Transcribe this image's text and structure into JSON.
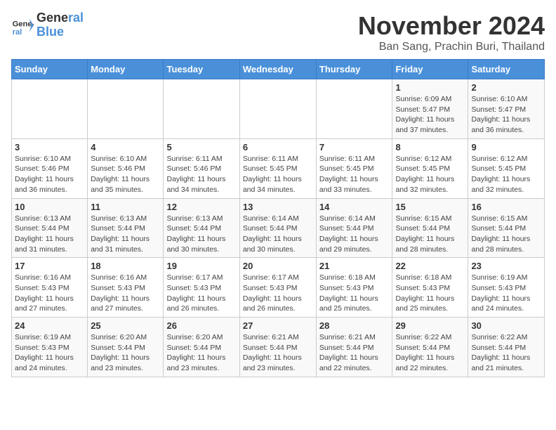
{
  "logo": {
    "line1": "General",
    "line2": "Blue"
  },
  "title": "November 2024",
  "location": "Ban Sang, Prachin Buri, Thailand",
  "weekdays": [
    "Sunday",
    "Monday",
    "Tuesday",
    "Wednesday",
    "Thursday",
    "Friday",
    "Saturday"
  ],
  "weeks": [
    [
      {
        "day": "",
        "info": ""
      },
      {
        "day": "",
        "info": ""
      },
      {
        "day": "",
        "info": ""
      },
      {
        "day": "",
        "info": ""
      },
      {
        "day": "",
        "info": ""
      },
      {
        "day": "1",
        "info": "Sunrise: 6:09 AM\nSunset: 5:47 PM\nDaylight: 11 hours and 37 minutes."
      },
      {
        "day": "2",
        "info": "Sunrise: 6:10 AM\nSunset: 5:47 PM\nDaylight: 11 hours and 36 minutes."
      }
    ],
    [
      {
        "day": "3",
        "info": "Sunrise: 6:10 AM\nSunset: 5:46 PM\nDaylight: 11 hours and 36 minutes."
      },
      {
        "day": "4",
        "info": "Sunrise: 6:10 AM\nSunset: 5:46 PM\nDaylight: 11 hours and 35 minutes."
      },
      {
        "day": "5",
        "info": "Sunrise: 6:11 AM\nSunset: 5:46 PM\nDaylight: 11 hours and 34 minutes."
      },
      {
        "day": "6",
        "info": "Sunrise: 6:11 AM\nSunset: 5:45 PM\nDaylight: 11 hours and 34 minutes."
      },
      {
        "day": "7",
        "info": "Sunrise: 6:11 AM\nSunset: 5:45 PM\nDaylight: 11 hours and 33 minutes."
      },
      {
        "day": "8",
        "info": "Sunrise: 6:12 AM\nSunset: 5:45 PM\nDaylight: 11 hours and 32 minutes."
      },
      {
        "day": "9",
        "info": "Sunrise: 6:12 AM\nSunset: 5:45 PM\nDaylight: 11 hours and 32 minutes."
      }
    ],
    [
      {
        "day": "10",
        "info": "Sunrise: 6:13 AM\nSunset: 5:44 PM\nDaylight: 11 hours and 31 minutes."
      },
      {
        "day": "11",
        "info": "Sunrise: 6:13 AM\nSunset: 5:44 PM\nDaylight: 11 hours and 31 minutes."
      },
      {
        "day": "12",
        "info": "Sunrise: 6:13 AM\nSunset: 5:44 PM\nDaylight: 11 hours and 30 minutes."
      },
      {
        "day": "13",
        "info": "Sunrise: 6:14 AM\nSunset: 5:44 PM\nDaylight: 11 hours and 30 minutes."
      },
      {
        "day": "14",
        "info": "Sunrise: 6:14 AM\nSunset: 5:44 PM\nDaylight: 11 hours and 29 minutes."
      },
      {
        "day": "15",
        "info": "Sunrise: 6:15 AM\nSunset: 5:44 PM\nDaylight: 11 hours and 28 minutes."
      },
      {
        "day": "16",
        "info": "Sunrise: 6:15 AM\nSunset: 5:44 PM\nDaylight: 11 hours and 28 minutes."
      }
    ],
    [
      {
        "day": "17",
        "info": "Sunrise: 6:16 AM\nSunset: 5:43 PM\nDaylight: 11 hours and 27 minutes."
      },
      {
        "day": "18",
        "info": "Sunrise: 6:16 AM\nSunset: 5:43 PM\nDaylight: 11 hours and 27 minutes."
      },
      {
        "day": "19",
        "info": "Sunrise: 6:17 AM\nSunset: 5:43 PM\nDaylight: 11 hours and 26 minutes."
      },
      {
        "day": "20",
        "info": "Sunrise: 6:17 AM\nSunset: 5:43 PM\nDaylight: 11 hours and 26 minutes."
      },
      {
        "day": "21",
        "info": "Sunrise: 6:18 AM\nSunset: 5:43 PM\nDaylight: 11 hours and 25 minutes."
      },
      {
        "day": "22",
        "info": "Sunrise: 6:18 AM\nSunset: 5:43 PM\nDaylight: 11 hours and 25 minutes."
      },
      {
        "day": "23",
        "info": "Sunrise: 6:19 AM\nSunset: 5:43 PM\nDaylight: 11 hours and 24 minutes."
      }
    ],
    [
      {
        "day": "24",
        "info": "Sunrise: 6:19 AM\nSunset: 5:43 PM\nDaylight: 11 hours and 24 minutes."
      },
      {
        "day": "25",
        "info": "Sunrise: 6:20 AM\nSunset: 5:44 PM\nDaylight: 11 hours and 23 minutes."
      },
      {
        "day": "26",
        "info": "Sunrise: 6:20 AM\nSunset: 5:44 PM\nDaylight: 11 hours and 23 minutes."
      },
      {
        "day": "27",
        "info": "Sunrise: 6:21 AM\nSunset: 5:44 PM\nDaylight: 11 hours and 23 minutes."
      },
      {
        "day": "28",
        "info": "Sunrise: 6:21 AM\nSunset: 5:44 PM\nDaylight: 11 hours and 22 minutes."
      },
      {
        "day": "29",
        "info": "Sunrise: 6:22 AM\nSunset: 5:44 PM\nDaylight: 11 hours and 22 minutes."
      },
      {
        "day": "30",
        "info": "Sunrise: 6:22 AM\nSunset: 5:44 PM\nDaylight: 11 hours and 21 minutes."
      }
    ]
  ]
}
